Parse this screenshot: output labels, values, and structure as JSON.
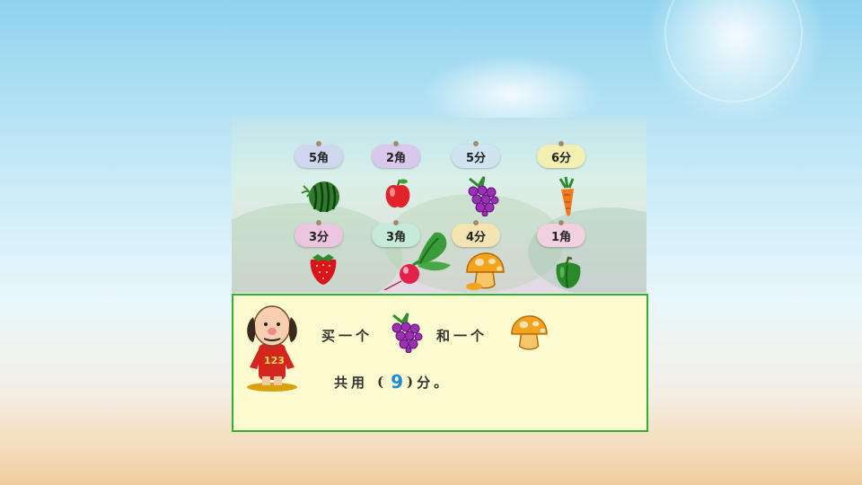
{
  "products": [
    {
      "price": "5角",
      "item": "watermelon-icon",
      "tag_color": "#cfd7ee"
    },
    {
      "price": "2角",
      "item": "apple-icon",
      "tag_color": "#d9c8ec"
    },
    {
      "price": "5分",
      "item": "grapes-icon",
      "tag_color": "#cfe3f1"
    },
    {
      "price": "6分",
      "item": "carrot-icon",
      "tag_color": "#f3efb1"
    },
    {
      "price": "3分",
      "item": "strawberry-icon",
      "tag_color": "#ecc6e0"
    },
    {
      "price": "3角",
      "item": "radish-icon",
      "tag_color": "#c6ead9"
    },
    {
      "price": "4分",
      "item": "mushroom-icon",
      "tag_color": "#f4e4b2"
    },
    {
      "price": "1角",
      "item": "green-pepper-icon",
      "tag_color": "#f1d0df"
    }
  ],
  "question": {
    "buy_one": "买一个",
    "and_one": "和一个",
    "total_prefix": "共用",
    "open_paren": "(",
    "answer": "9",
    "close_paren": ")",
    "unit_suffix": "分。",
    "item1": "grapes-icon",
    "item2": "mushroom-icon"
  },
  "character": {
    "shirt_number": "123",
    "icon": "teacher-character-icon"
  },
  "colors": {
    "box_border": "#32b032",
    "box_fill": "#fbfbcf",
    "answer": "#1a8bd6"
  }
}
